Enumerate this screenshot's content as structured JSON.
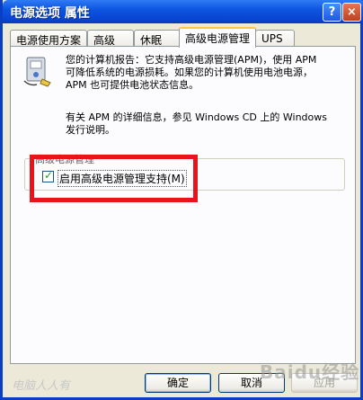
{
  "window": {
    "title": "电源选项 属性"
  },
  "title_buttons": {
    "help": "?",
    "close": "×"
  },
  "tabs": [
    {
      "label": "电源使用方案",
      "active": false
    },
    {
      "label": "高级",
      "active": false
    },
    {
      "label": "休眠",
      "active": false
    },
    {
      "label": "高级电源管理",
      "active": true
    },
    {
      "label": "UPS",
      "active": false
    }
  ],
  "apm": {
    "info_line1": "您的计算机报告：它支持高级电源管理(APM)，使用 APM",
    "info_line2": "可降低系统的电源损耗。如果您的计算机使用电池电源，",
    "info_line3": "APM 也可提供电池状态信息。",
    "more_line1": "有关 APM 的详细信息，参见 Windows CD 上的 Windows",
    "more_line2": "发行说明。",
    "group_title": "高级电源管理",
    "checkbox_label": "启用高级电源管理支持(M)",
    "checkbox_checked": true
  },
  "buttons": {
    "ok": "确定",
    "cancel": "取消",
    "apply": "应用"
  },
  "watermarks": {
    "left": "电脑人人有",
    "right": "Baidu经验"
  },
  "colors": {
    "highlight": "#e8141c",
    "title_bar": "#0d55e0"
  }
}
